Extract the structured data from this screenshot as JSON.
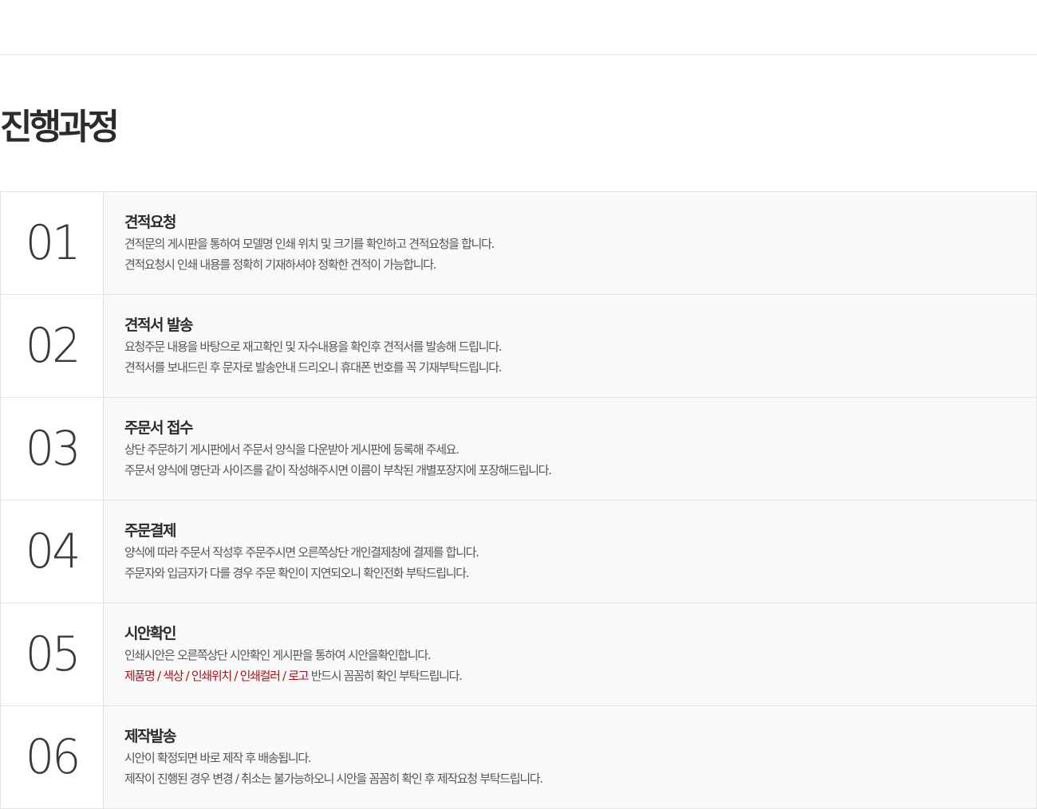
{
  "page": {
    "title": "진행과정"
  },
  "steps": [
    {
      "num": "01",
      "title": "견적요청",
      "lines": [
        "견적문의 게시판을 통하여 모델명 인쇄 위치 및 크기를 확인하고 견적요청을 합니다.",
        "견적요청시 인쇄 내용를 정확히 기재하셔야 정확한 견적이 가능합니다."
      ]
    },
    {
      "num": "02",
      "title": "견적서 발송",
      "lines": [
        "요청주문 내용을 바탕으로 재고확인 및 자수내용을 확인후 견적서를 발송해 드립니다.",
        "견적서를 보내드린 후 문자로 발송안내 드리오니 휴대폰 번호를 꼭 기재부탁드립니다."
      ]
    },
    {
      "num": "03",
      "title": "주문서 접수",
      "lines": [
        "상단 주문하기 게시판에서 주문서 양식을 다운받아 게시판에 등록해 주세요.",
        "주문서 양식에 명단과 사이즈를 같이 작성해주시면 이름이 부착된 개별포장지에 포장해드립니다."
      ]
    },
    {
      "num": "04",
      "title": "주문결제",
      "lines": [
        "양식에 따라 주문서 작성후 주문주시면 오른쪽상단 개인결제창에 결제를 합니다.",
        "주문자와 입금자가 다를 경우 주문 확인이 지연되오니 확인전화 부탁드립니다."
      ]
    },
    {
      "num": "05",
      "title": "시안확인",
      "lines": [
        "인쇄시안은 오른쪽상단 시안확인 게시판을 통하여 시안을확인합니다."
      ],
      "highlight_line": {
        "red_text": "제품명 / 색상 / 인쇄위치 / 인쇄컬러 / 로고",
        "rest_text": " 반드시 꼼꼼히 확인 부탁드립니다."
      }
    },
    {
      "num": "06",
      "title": "제작발송",
      "lines": [
        "시안이 확정되면 바로 제작 후 배송됩니다.",
        "제작이 진행된 경우 변경 / 취소는 불가능하오니 시안을 꼼꼼히 확인 후 제작요청 부탁드립니다."
      ]
    }
  ],
  "colors": {
    "highlight": "#a8111b",
    "border": "#e3e3e3",
    "body_bg": "#f9f9f9"
  }
}
